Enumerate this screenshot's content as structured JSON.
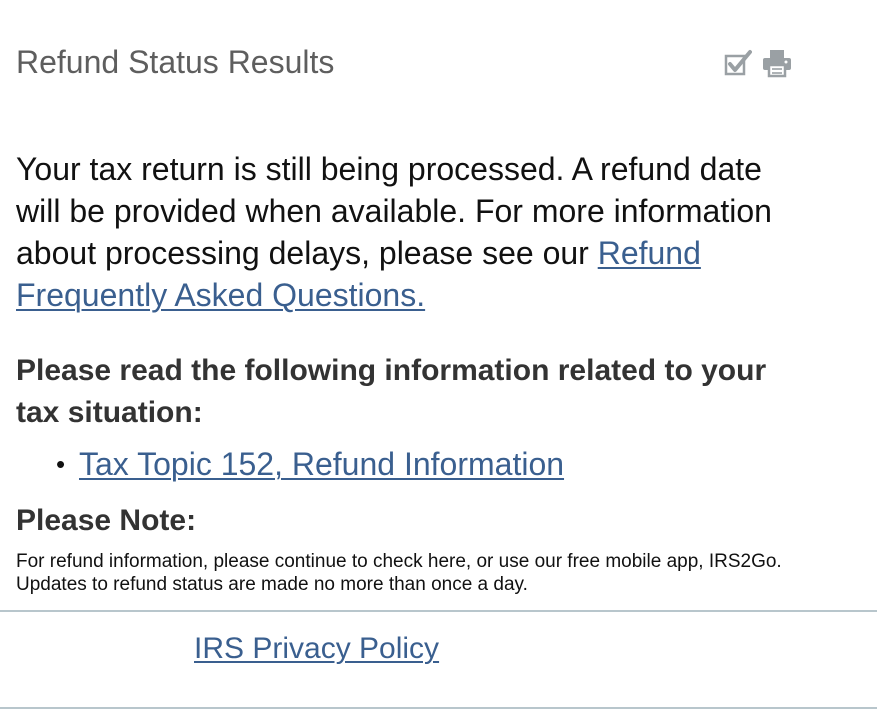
{
  "header": {
    "title": "Refund Status Results",
    "icons": [
      "checkmark-icon",
      "print-icon"
    ]
  },
  "status": {
    "message": "Your tax return is still being processed. A refund date will be provided when available. For more information about processing delays, please see our ",
    "faq_link": "Refund Frequently Asked Questions."
  },
  "info": {
    "heading": "Please read the following information related to your tax situation:",
    "topics": [
      "Tax Topic 152, Refund Information"
    ]
  },
  "note": {
    "heading": "Please Note:",
    "text": "For refund information, please continue to check here, or use our free mobile app, IRS2Go. Updates to refund status are made no more than once a day."
  },
  "footer": {
    "privacy_link": "IRS Privacy Policy"
  },
  "colors": {
    "link": "#3a5f8f",
    "title": "#5e5e5e",
    "icon": "#9aa0a4"
  }
}
